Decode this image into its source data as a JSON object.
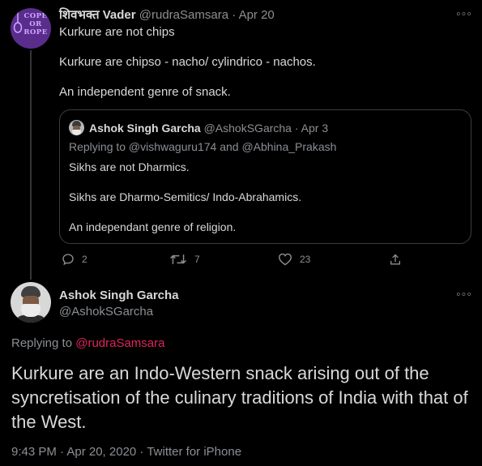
{
  "tweet1": {
    "avatar_text": [
      "COPE",
      "OR",
      "ROPE"
    ],
    "display_name": "शिवभक्त Vader",
    "handle": "@rudraSamsara",
    "separator": "·",
    "date": "Apr 20",
    "more_label": "◦◦◦",
    "paragraphs": [
      "Kurkure are not chips",
      "Kurkure are chipso - nacho/ cylindrico - nachos.",
      "An independent genre of snack."
    ],
    "quoted": {
      "display_name": "Ashok Singh Garcha",
      "handle": "@AshokSGarcha",
      "separator": "·",
      "date": "Apr 3",
      "replying_to": "Replying to @vishwaguru174 and @Abhina_Prakash",
      "paragraphs": [
        "Sikhs are not Dharmics.",
        "Sikhs are Dharmo-Semitics/ Indo-Abrahamics.",
        "An independant genre of religion."
      ]
    },
    "actions": {
      "reply_count": "2",
      "retweet_count": "7",
      "like_count": "23"
    }
  },
  "tweet2": {
    "display_name": "Ashok Singh Garcha",
    "handle": "@AshokSGarcha",
    "more_label": "◦◦◦",
    "replying_prefix": "Replying to ",
    "replying_mention": "@rudraSamsara",
    "body": "Kurkure are an Indo-Western snack arising out of the syncretisation of the culinary traditions of India with that of the West.",
    "meta": "9:43 PM · Apr 20, 2020 · Twitter for iPhone"
  },
  "colors": {
    "background": "#000000",
    "text": "#d9d9d9",
    "muted": "#8b8f94",
    "mention": "#e0245e",
    "border": "#3a3d40"
  }
}
